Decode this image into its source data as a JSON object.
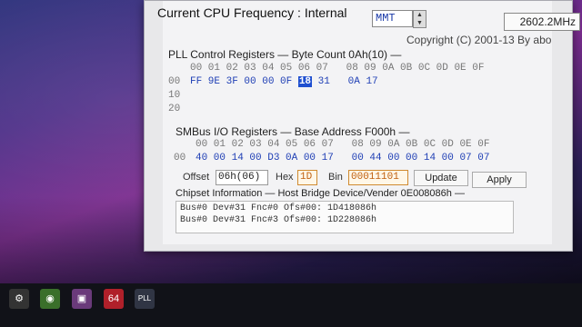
{
  "window": {
    "cpu_freq_label": "Current CPU Frequency : Internal",
    "mmt_value": "MMT",
    "spinner_up": "▲",
    "spinner_down": "▼",
    "freq_value": "2602.2MHz",
    "copyright": "Copyright (C) 2001-13 By abo"
  },
  "pll": {
    "title": "PLL Control Registers — Byte Count 0Ah(10) —",
    "header_row": "00 01 02 03 04 05 06 07   08 09 0A 0B 0C 0D 0E 0F",
    "row_labels": [
      "00",
      "10",
      "20"
    ],
    "row0_before": "FF 9E 3F 00 00 0F ",
    "row0_selected": "18",
    "row0_after": " 31   0A 17"
  },
  "smbus": {
    "title": "SMBus I/O Registers — Base Address F000h —",
    "header_row": "00 01 02 03 04 05 06 07   08 09 0A 0B 0C 0D 0E 0F",
    "row_label": "00",
    "row0": "40 00 14 00 D3 0A 00 17   00 44 00 00 14 00 07 07"
  },
  "controls": {
    "offset_label": "Offset",
    "offset_value": "06h(06)",
    "hex_label": "Hex",
    "hex_value": "1D",
    "bin_label": "Bin",
    "bin_value": "00011101",
    "update_label": "Update",
    "apply_label": "Apply"
  },
  "chipset": {
    "title": "Chipset Information — Host Bridge Device/Vender 0E008086h —",
    "lines": [
      "Bus#0 Dev#31 Fnc#0 Ofs#00: 1D418086h",
      "Bus#0 Dev#31 Fnc#3 Ofs#00: 1D228086h"
    ]
  },
  "taskbar": {
    "items": [
      {
        "icon": "gear-icon",
        "label": "⚙"
      },
      {
        "icon": "chrome-icon",
        "label": "◉"
      },
      {
        "icon": "media-icon",
        "label": "▣"
      },
      {
        "icon": "app-64-icon",
        "label": "64"
      },
      {
        "icon": "pll-app-icon",
        "label": "PLL"
      }
    ]
  }
}
